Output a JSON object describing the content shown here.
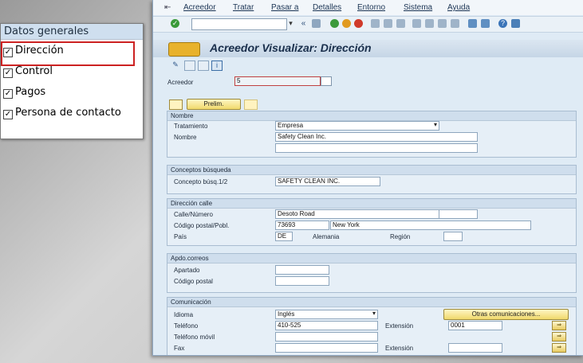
{
  "checklist": {
    "title": "Datos generales",
    "items": [
      {
        "label": "Dirección",
        "checked": true,
        "selected": true
      },
      {
        "label": "Control",
        "checked": true,
        "selected": false
      },
      {
        "label": "Pagos",
        "checked": true,
        "selected": false
      },
      {
        "label": "Persona de contacto",
        "checked": true,
        "selected": false
      }
    ]
  },
  "menu": {
    "items": [
      "Acreedor",
      "Tratar",
      "Pasar a",
      "Detalles",
      "Entorno",
      "Sistema",
      "Ayuda"
    ]
  },
  "toolbar": {
    "nav_back": "«"
  },
  "screen": {
    "title": "Acreedor Visualizar: Dirección",
    "vendor_label": "Acreedor",
    "vendor_value": "5",
    "prelim_button": "Prelim."
  },
  "groups": {
    "nombre": {
      "title": "Nombre",
      "tratamiento_label": "Tratamiento",
      "tratamiento_value": "Empresa",
      "nombre_label": "Nombre",
      "nombre_value": "Safety Clean Inc."
    },
    "busqueda": {
      "title": "Conceptos búsqueda",
      "concepto_label": "Concepto búsq.1/2",
      "concepto_value": "SAFETY CLEAN INC."
    },
    "direccion": {
      "title": "Dirección calle",
      "calle_label": "Calle/Número",
      "calle_value": "Desoto Road",
      "cp_label": "Código postal/Pobl.",
      "cp_value": "73693",
      "poblacion_value": "New York",
      "pais_label": "País",
      "pais_value": "DE",
      "pais_name": "Alemania",
      "region_label": "Región"
    },
    "apdo": {
      "title": "Apdo.correos",
      "apartado_label": "Apartado",
      "cp_label": "Código postal"
    },
    "comunicacion": {
      "title": "Comunicación",
      "idioma_label": "Idioma",
      "idioma_value": "Inglés",
      "otras_button": "Otras comunicaciones...",
      "telefono_label": "Teléfono",
      "telefono_value": "410-525",
      "extension_label": "Extensión",
      "extension_value": "0001",
      "movil_label": "Teléfono móvil",
      "fax_label": "Fax",
      "fax_extension_label": "Extensión"
    }
  },
  "colors": {
    "highlight": "#cc2222",
    "sap_bg": "#dfebf5",
    "button_yellow": "#f0d96b"
  }
}
